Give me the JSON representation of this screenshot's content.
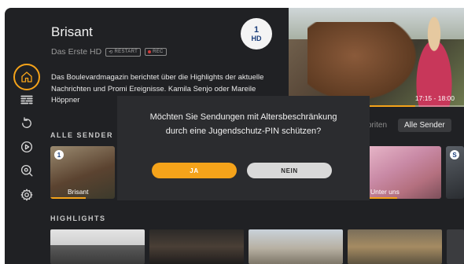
{
  "hero": {
    "title": "Brisant",
    "channel": "Das Erste HD",
    "tags": {
      "restart": "RESTART",
      "rec": "REC"
    },
    "description": "Das Boulevardmagazin berichtet über die Highlights der aktuelle Nachrichten und Promi Ereignisse. Kamila Senjo oder Mareile Höppner",
    "logo": {
      "line1": "1",
      "line2": "HD"
    }
  },
  "preview": {
    "time": "17:15 - 18:00",
    "progress": 0.72
  },
  "sections": {
    "channels": "ALLE SENDER",
    "highlights": "HIGHLIGHTS"
  },
  "filters": [
    {
      "label": "voriten",
      "selected": false
    },
    {
      "label": "Alle Sender",
      "selected": true
    }
  ],
  "channels": [
    {
      "label": "Brisant",
      "badge": "1",
      "progress": 0.55
    },
    {
      "label": "",
      "badge": "",
      "progress": 0
    },
    {
      "label": "Unter uns",
      "badge": "",
      "progress": 0.4
    },
    {
      "label": "",
      "badge": "S",
      "progress": 0
    }
  ],
  "dialog": {
    "line1": "Möchten Sie Sendungen mit Altersbeschränkung",
    "line2": "durch eine Jugendschutz-PIN schützen?",
    "yes": "JA",
    "no": "NEIN"
  },
  "sidebar": [
    "home-icon",
    "guide-icon",
    "replay-icon",
    "play-icon",
    "search-icon",
    "settings-icon"
  ],
  "colors": {
    "accent": "#f5a31a",
    "background": "#202124",
    "dialog": "#2b2c2f",
    "rec": "#d23a3a"
  }
}
